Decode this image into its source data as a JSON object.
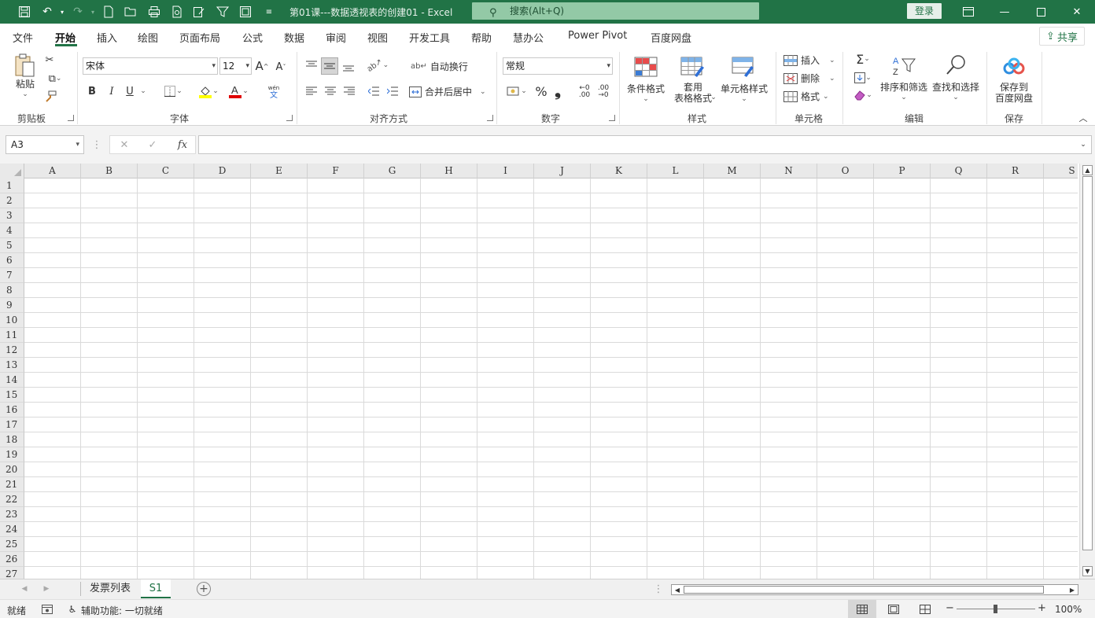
{
  "window": {
    "title": "第01课---数据透视表的创建01  -  Excel",
    "search_placeholder": "搜索(Alt+Q)",
    "login_label": "登录",
    "accent_color": "#217346"
  },
  "menu": {
    "tabs": [
      "文件",
      "开始",
      "插入",
      "绘图",
      "页面布局",
      "公式",
      "数据",
      "审阅",
      "视图",
      "开发工具",
      "帮助",
      "慧办公",
      "Power Pivot",
      "百度网盘"
    ],
    "active_tab": "开始",
    "share_label": "共享"
  },
  "ribbon": {
    "clipboard": {
      "paste_label": "粘贴",
      "group_label": "剪贴板"
    },
    "font": {
      "font_name": "宋体",
      "font_size": "12",
      "bold": "B",
      "italic": "I",
      "underline": "U",
      "group_label": "字体",
      "phonetic_top": "wén",
      "phonetic_bottom": "文"
    },
    "alignment": {
      "wrap_text": "自动换行",
      "merge_center": "合并后居中",
      "group_label": "对齐方式"
    },
    "number": {
      "format": "常规",
      "percent": "%",
      "comma": "❟",
      "group_label": "数字"
    },
    "styles": {
      "conditional": "条件格式",
      "table_line1": "套用",
      "table_line2": "表格格式",
      "cell_styles": "单元格样式",
      "group_label": "样式"
    },
    "cells": {
      "insert": "插入",
      "delete": "删除",
      "format": "格式",
      "group_label": "单元格"
    },
    "editing": {
      "sort_filter": "排序和筛选",
      "find_select": "查找和选择",
      "group_label": "编辑"
    },
    "save": {
      "line1": "保存到",
      "line2": "百度网盘",
      "group_label": "保存"
    }
  },
  "formula_bar": {
    "name_box": "A3",
    "fx": "fx",
    "value": ""
  },
  "grid": {
    "columns": [
      "A",
      "B",
      "C",
      "D",
      "E",
      "F",
      "G",
      "H",
      "I",
      "J",
      "K",
      "L",
      "M",
      "N",
      "O",
      "P",
      "Q",
      "R",
      "S"
    ],
    "rows": [
      "1",
      "2",
      "3",
      "4",
      "5",
      "6",
      "7",
      "8",
      "9",
      "10",
      "11",
      "12",
      "13",
      "14",
      "15",
      "16",
      "17",
      "18",
      "19",
      "20",
      "21",
      "22",
      "23",
      "24",
      "25",
      "26",
      "27"
    ]
  },
  "sheets": {
    "tabs": [
      "发票列表",
      "S1"
    ],
    "active": "S1"
  },
  "status": {
    "ready": "就绪",
    "accessibility": "辅助功能: 一切就绪",
    "zoom": "100%"
  }
}
